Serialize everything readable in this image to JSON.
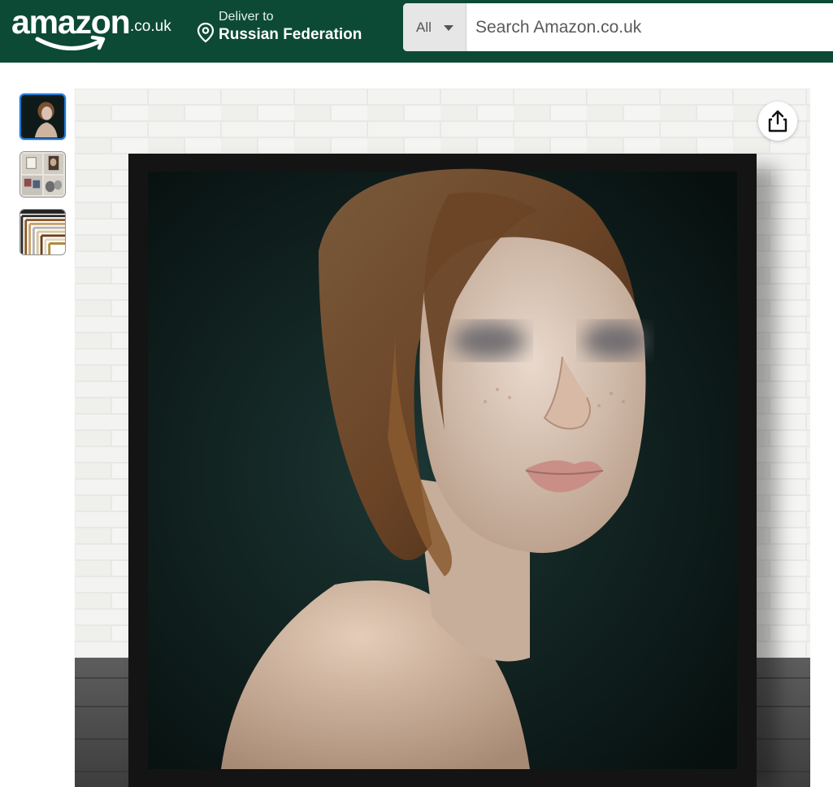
{
  "header": {
    "logo": {
      "wordmark": "amazon",
      "tld": ".co.uk"
    },
    "deliver": {
      "line1": "Deliver to",
      "line2": "Russian Federation"
    },
    "search": {
      "department": "All",
      "placeholder": "Search Amazon.co.uk"
    }
  },
  "colors": {
    "header_bg": "#0c4a36",
    "thumb_selected_border": "#1f7ad4",
    "smile": "#ffffff"
  },
  "gallery": {
    "thumbnails": [
      {
        "icon": "portrait-thumbnail",
        "selected": true
      },
      {
        "icon": "room-collage-thumbnail",
        "selected": false
      },
      {
        "icon": "frame-samples-thumbnail",
        "selected": false
      }
    ],
    "share_icon": "share-icon",
    "main_image_icon": "framed-portrait-image"
  }
}
